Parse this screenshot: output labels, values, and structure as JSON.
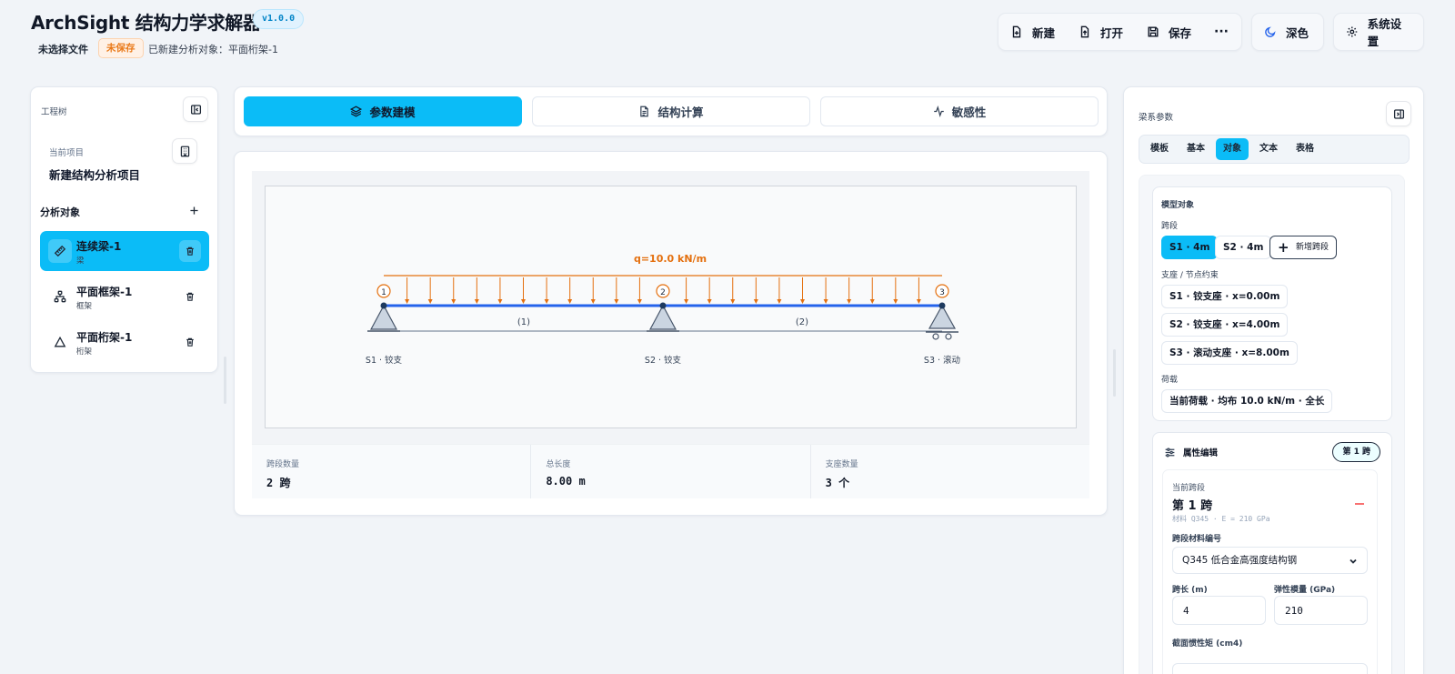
{
  "header": {
    "app_title": "ArchSight 结构力学求解器",
    "version": "v1.0.0",
    "file_status": "未选择文件",
    "unsaved": "未保存",
    "created_text": "已新建分析对象：平面桁架-1"
  },
  "toolbar": {
    "new_label": "新建",
    "open_label": "打开",
    "save_label": "保存",
    "more_label": "···",
    "theme_label": "深色",
    "settings_label": "系统设置"
  },
  "left_panel": {
    "title": "工程树",
    "project_label": "当前项目",
    "project_name": "新建结构分析项目",
    "analysis_title": "分析对象",
    "items": [
      {
        "name": "连续梁-1",
        "type": "梁",
        "icon": "ruler-icon",
        "active": true
      },
      {
        "name": "平面框架-1",
        "type": "框架",
        "icon": "network-icon",
        "active": false
      },
      {
        "name": "平面桁架-1",
        "type": "桁架",
        "icon": "triangle-icon",
        "active": false
      }
    ]
  },
  "main_tabs": [
    {
      "label": "参数建模",
      "icon": "layers-icon",
      "active": true
    },
    {
      "label": "结构计算",
      "icon": "document-icon",
      "active": false
    },
    {
      "label": "敏感性",
      "icon": "activity-icon",
      "active": false
    }
  ],
  "diagram": {
    "load_label": "q=10.0 kN/m",
    "nodes": [
      "1",
      "2",
      "3"
    ],
    "span_labels": [
      "(1)",
      "(2)"
    ],
    "support_labels": [
      "S1 · 铰支",
      "S2 · 铰支",
      "S3 · 滚动"
    ],
    "load_color": "#e4700f",
    "beam_color": "#2563eb"
  },
  "stats": [
    {
      "label": "跨段数量",
      "value": "2 跨"
    },
    {
      "label": "总长度",
      "value": "8.00 m"
    },
    {
      "label": "支座数量",
      "value": "3 个"
    }
  ],
  "right_panel": {
    "title": "梁系参数",
    "sub_tabs": [
      {
        "label": "模板",
        "active": false
      },
      {
        "label": "基本",
        "active": false
      },
      {
        "label": "对象",
        "active": true
      },
      {
        "label": "文本",
        "active": false
      },
      {
        "label": "表格",
        "active": false
      }
    ],
    "model_objects_label": "模型对象",
    "spans_label": "跨段",
    "spans": [
      "S1 · 4m",
      "S2 · 4m"
    ],
    "add_span_label": "新增跨段",
    "supports_label": "支座 / 节点约束",
    "supports": [
      "S1 · 铰支座 · x=0.00m",
      "S2 · 铰支座 · x=4.00m",
      "S3 · 滚动支座 · x=8.00m"
    ],
    "loads_label": "荷载",
    "load_item": "当前荷载 · 均布 10.0 kN/m · 全长",
    "props_title": "属性编辑",
    "span_badge": "第 1 跨",
    "current_span_label": "当前跨段",
    "current_span_value": "第 1 跨",
    "current_span_meta": "材料 Q345 · E = 210 GPa",
    "material_label": "跨段材料编号",
    "material_value": "Q345 低合金高强度结构钢",
    "length_label": "跨长 (m)",
    "length_value": "4",
    "modulus_label": "弹性模量 (GPa)",
    "modulus_value": "210",
    "inertia_label": "截面惯性矩 (cm4)"
  },
  "colors": {
    "accent": "#0bbcf7",
    "background": "#f1f4f8"
  }
}
